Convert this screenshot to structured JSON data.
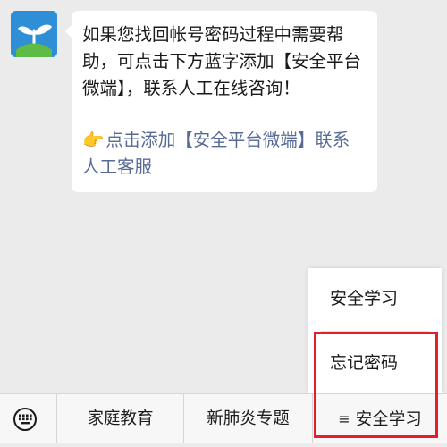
{
  "chat": {
    "message": {
      "text": "如果您找回帐号密码过程中需要帮助，可点击下方蓝字添加【安全平台微端】，联系人工在线咨询！",
      "link_emoji": "👉",
      "link_text": "点击添加【安全平台微端】联系人工客服"
    }
  },
  "popup_menu": {
    "items": [
      {
        "label": "安全学习"
      },
      {
        "label": "忘记密码"
      }
    ]
  },
  "bottom_menu": {
    "keyboard_icon": "keyboard-icon",
    "items": [
      {
        "label": "家庭教育"
      },
      {
        "label": "新肺炎专题"
      },
      {
        "label": "安全学习",
        "icon": "≡"
      }
    ]
  },
  "colors": {
    "avatar_bg": "#2f8fd6",
    "link": "#576b95",
    "highlight": "#e0202c",
    "sprout_green": "#5dbb46"
  }
}
